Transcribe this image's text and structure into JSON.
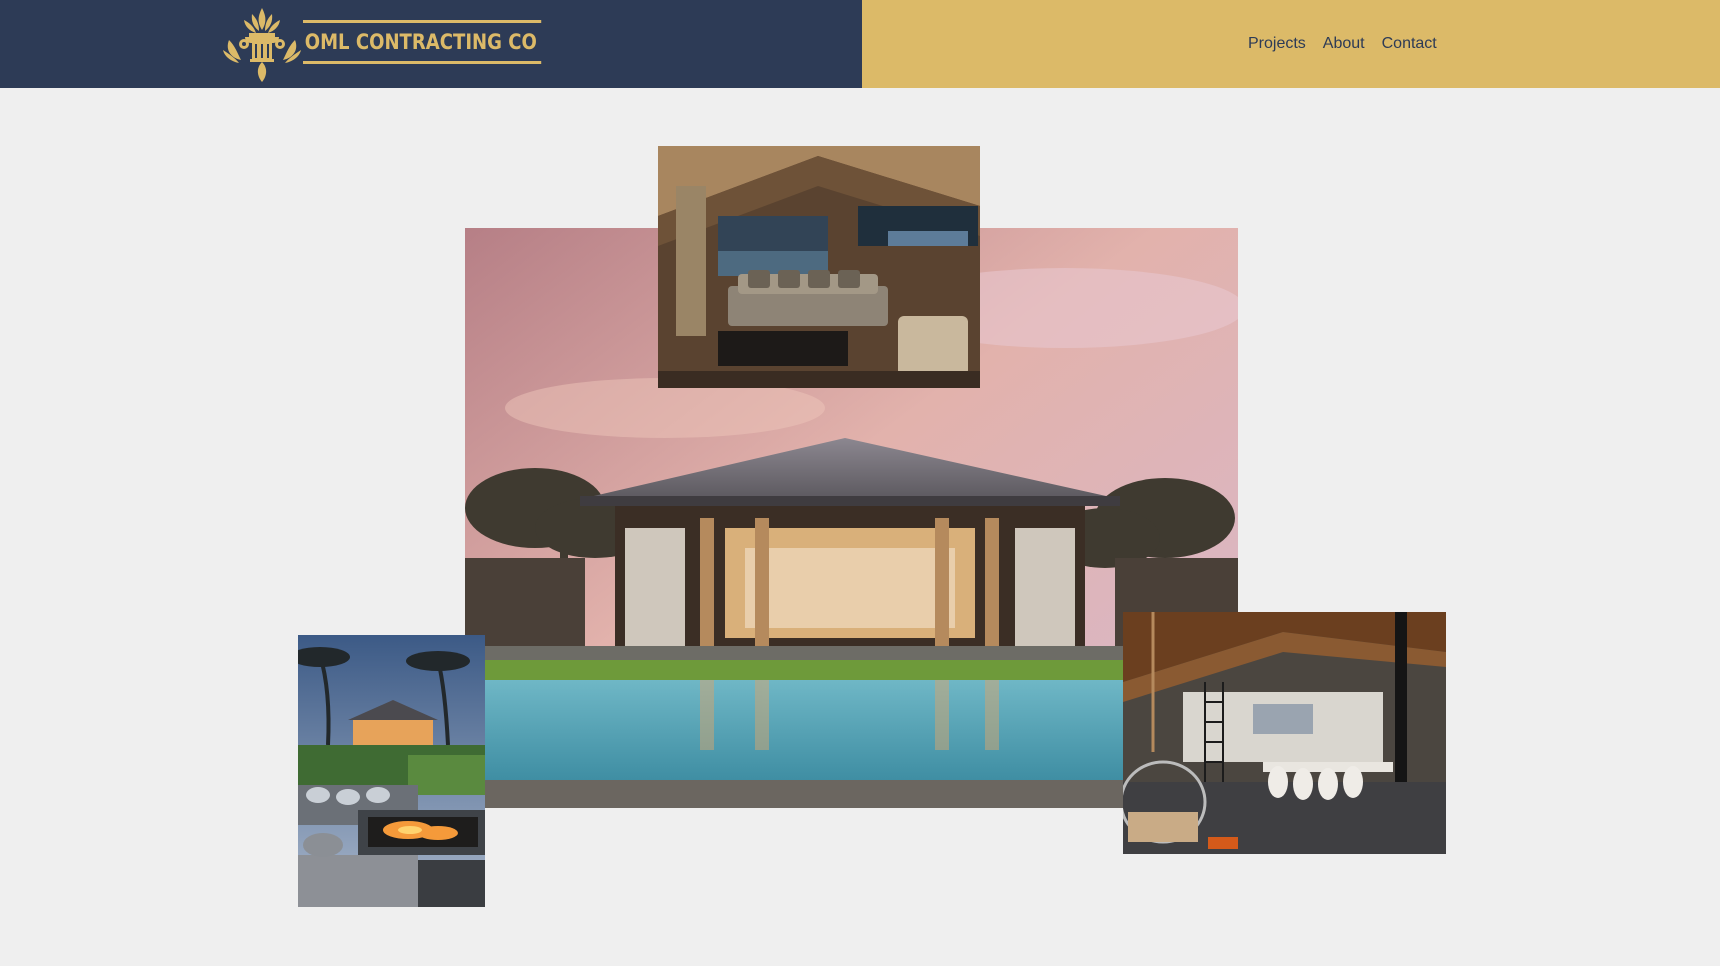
{
  "brand": {
    "name": "OML CONTRACTING CO",
    "logo_icon": "column-laurel-icon",
    "colors": {
      "navy": "#2d3b56",
      "gold": "#dcba68",
      "background": "#efefef"
    }
  },
  "nav": {
    "items": [
      {
        "label": "Projects"
      },
      {
        "label": "About"
      },
      {
        "label": "Contact"
      }
    ]
  },
  "gallery": {
    "images": [
      {
        "subject": "pavilion-pool-house-at-dusk"
      },
      {
        "subject": "living-room-interior"
      },
      {
        "subject": "firepit-lounge-with-palms"
      },
      {
        "subject": "dining-interior-with-hanging-chair"
      }
    ]
  }
}
